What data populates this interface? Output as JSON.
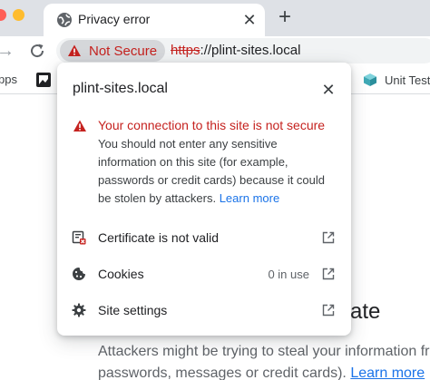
{
  "tab": {
    "title": "Privacy error",
    "close_glyph": "✕",
    "favicon": "globe-icon"
  },
  "new_tab_glyph": "+",
  "toolbar": {
    "forward_glyph": "→",
    "security_chip_label": "Not Secure",
    "url_scheme": "https",
    "url_rest": "://plint-sites.local"
  },
  "bookmarks": {
    "apps_label": "pps",
    "unit_label": "Unit Test"
  },
  "popup": {
    "site": "plint-sites.local",
    "close_glyph": "✕",
    "warning_heading": "Your connection to this site is not secure",
    "warning_lines": [
      "You should not enter any sensitive",
      "information on this site (for example,",
      "passwords or credit cards) because it could",
      "be stolen by attackers."
    ],
    "learn_more": "Learn more",
    "items": [
      {
        "label": "Certificate is not valid",
        "value": "",
        "icon": "certificate-icon"
      },
      {
        "label": "Cookies",
        "value": "0 in use",
        "icon": "cookie-icon"
      },
      {
        "label": "Site settings",
        "value": "",
        "icon": "gear-icon"
      }
    ]
  },
  "page": {
    "heading_tail": "ate",
    "text_line1": "Attackers might be trying to steal your information fro",
    "text_line2": "passwords, messages or credit cards).",
    "learn_more": "Learn more"
  },
  "colors": {
    "danger": "#c5221f",
    "link": "#1a73e8",
    "tabstrip": "#dee1e6",
    "chip": "#d5d7da",
    "omnibox": "#f1f3f4"
  }
}
